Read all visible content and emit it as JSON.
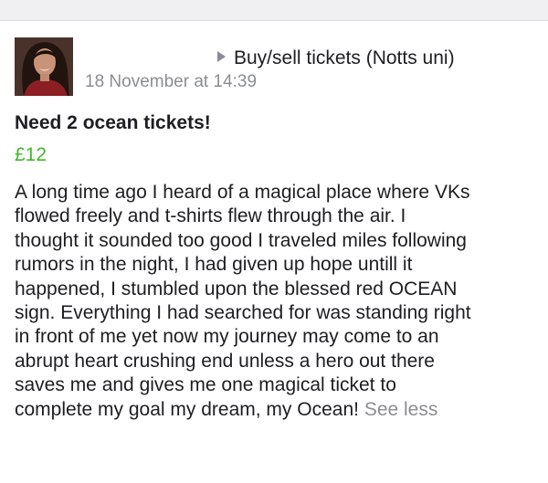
{
  "post": {
    "group_name": "Buy/sell tickets (Notts uni)",
    "timestamp": "18 November at 14:39",
    "title": "Need 2 ocean tickets!",
    "price": "£12",
    "body_lines": [
      "A long time ago I heard of a magical place where VKs",
      "flowed freely and t-shirts flew through the air. I",
      "thought it sounded too good I traveled miles following",
      "rumors in the night, I had given up hope untill it",
      "happened, I stumbled upon the blessed red OCEAN",
      "sign. Everything I had searched for was standing right",
      "in front of me yet now my journey may come to an",
      "abrupt heart crushing end unless a hero out there",
      "saves me and gives me one magical ticket to",
      "complete my goal  my dream, my Ocean!"
    ],
    "see_less_label": "See less"
  },
  "colors": {
    "price": "#42b72a",
    "muted": "#8a8d91",
    "text": "#1c1e21"
  },
  "icons": {
    "group_arrow": "triangle-right-icon"
  }
}
